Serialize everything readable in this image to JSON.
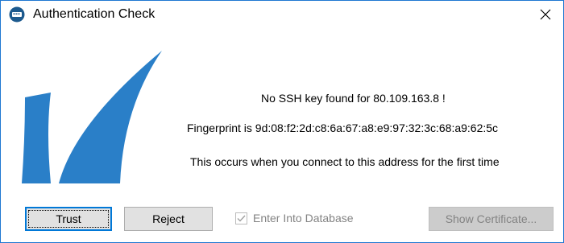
{
  "window": {
    "title": "Authentication Check",
    "icon": "barracuda-app-icon",
    "close_icon": "close-icon",
    "accent_color": "#1f78d1"
  },
  "logo": {
    "icon": "shark-fin-logo-icon",
    "color": "#2a7fc8"
  },
  "messages": {
    "no_key": "No SSH key found for 80.109.163.8 !",
    "fingerprint": "Fingerprint is 9d:08:f2:2d:c8:6a:67:a8:e9:97:32:3c:68:a9:62:5c",
    "first_time": "This occurs when you connect to this address for the first time"
  },
  "buttons": {
    "trust": "Trust",
    "reject": "Reject",
    "show_certificate": "Show Certificate..."
  },
  "checkbox": {
    "label": "Enter Into Database",
    "checked": true,
    "enabled": false
  }
}
